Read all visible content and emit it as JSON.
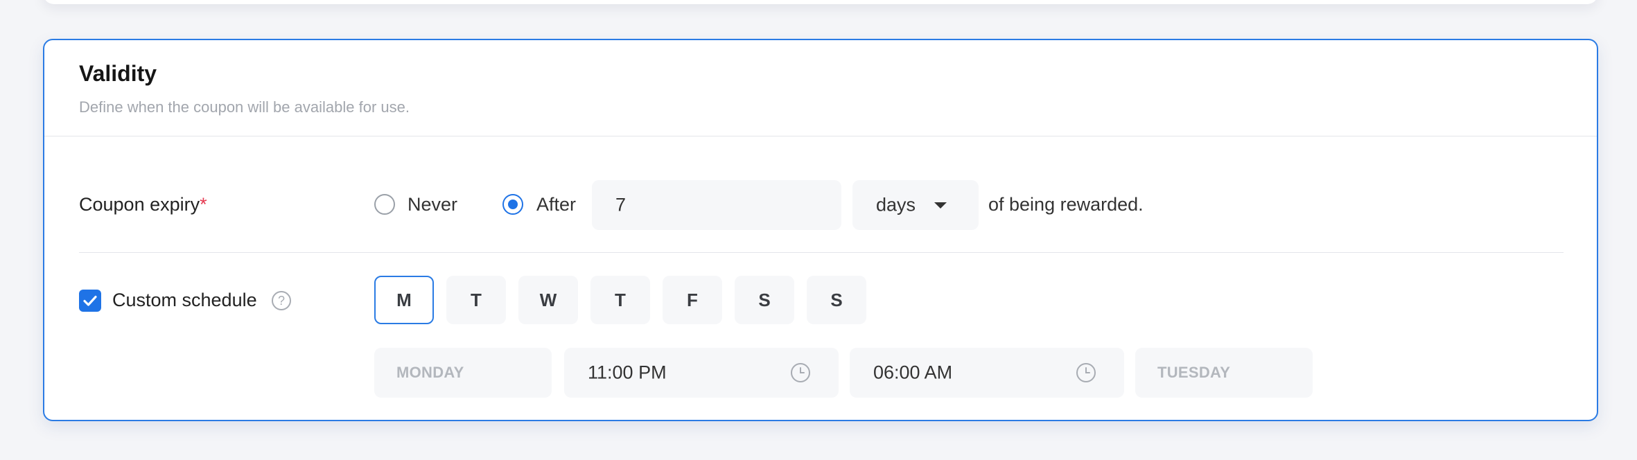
{
  "validity": {
    "title": "Validity",
    "subtitle": "Define when the coupon will be available for use."
  },
  "expiry": {
    "label": "Coupon expiry",
    "required_mark": "*",
    "option_never": "Never",
    "option_after": "After",
    "selected": "After",
    "amount_value": "7",
    "unit_value": "days",
    "suffix": "of being rewarded."
  },
  "schedule": {
    "checked": true,
    "label": "Custom schedule",
    "help_glyph": "?",
    "days": [
      {
        "label": "M",
        "active": true
      },
      {
        "label": "T",
        "active": false
      },
      {
        "label": "W",
        "active": false
      },
      {
        "label": "T",
        "active": false
      },
      {
        "label": "F",
        "active": false
      },
      {
        "label": "S",
        "active": false
      },
      {
        "label": "S",
        "active": false
      }
    ],
    "start_day": "MONDAY",
    "start_time": "11:00 PM",
    "end_time": "06:00 AM",
    "end_day": "TUESDAY"
  },
  "colors": {
    "accent": "#1f73e6",
    "required": "#e53950"
  }
}
